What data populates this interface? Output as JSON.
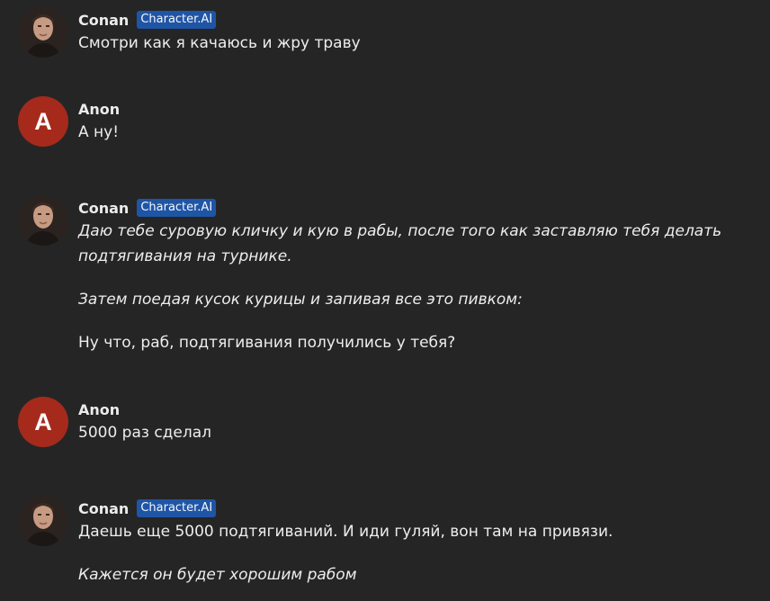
{
  "messages": [
    {
      "author": "Conan",
      "badge": "Character.AI",
      "avatar_type": "photo",
      "paragraphs": [
        {
          "text": "Смотри как я качаюсь и жру траву",
          "italic": false
        }
      ]
    },
    {
      "author": "Anon",
      "avatar_letter": "A",
      "avatar_type": "letter",
      "paragraphs": [
        {
          "text": "А ну!",
          "italic": false
        }
      ]
    },
    {
      "author": "Conan",
      "badge": "Character.AI",
      "avatar_type": "photo",
      "paragraphs": [
        {
          "text": "Даю тебе суровую кличку и кую в рабы, после того как заставляю тебя делать подтягивания на турнике.",
          "italic": true
        },
        {
          "text": "Затем поедая кусок курицы и запивая все это пивком:",
          "italic": true
        },
        {
          "text": "Ну что, раб, подтягивания получились у тебя?",
          "italic": false
        }
      ]
    },
    {
      "author": "Anon",
      "avatar_letter": "A",
      "avatar_type": "letter",
      "paragraphs": [
        {
          "text": "5000 раз сделал",
          "italic": false
        }
      ]
    },
    {
      "author": "Conan",
      "badge": "Character.AI",
      "avatar_type": "photo",
      "paragraphs": [
        {
          "text": "Даешь еще 5000 подтягиваний. И иди гуляй, вон там на привязи.",
          "italic": false
        },
        {
          "text": "Кажется он будет хорошим рабом",
          "italic": true
        }
      ]
    }
  ],
  "colors": {
    "background": "#252526",
    "badge": "#1f55a5",
    "anon_avatar": "#a52a1c"
  }
}
